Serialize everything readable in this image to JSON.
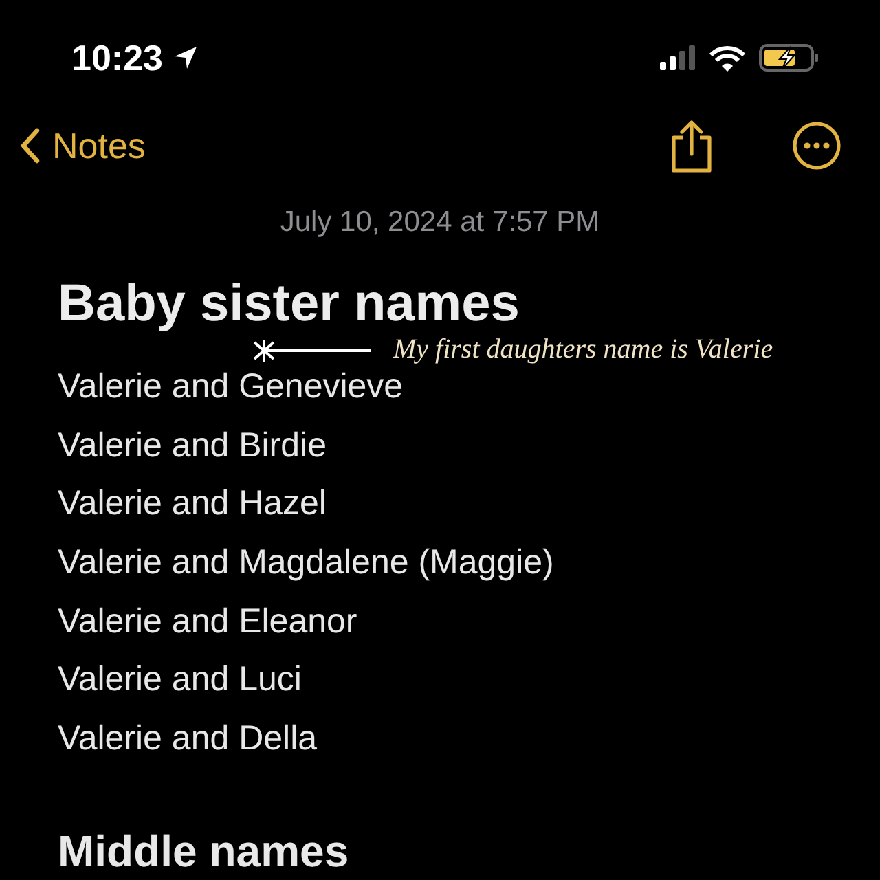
{
  "status_bar": {
    "time": "10:23"
  },
  "nav": {
    "back_label": "Notes"
  },
  "note": {
    "date": "July 10, 2024 at 7:57 PM",
    "title": "Baby sister names",
    "lines": [
      "Valerie and Genevieve",
      "Valerie and Birdie",
      "Valerie and Hazel",
      "Valerie and Magdalene (Maggie)",
      "Valerie and Eleanor",
      "Valerie and Luci",
      "Valerie and Della"
    ],
    "heading": "Middle names"
  },
  "annotation": {
    "text": "My first daughters name is Valerie"
  }
}
